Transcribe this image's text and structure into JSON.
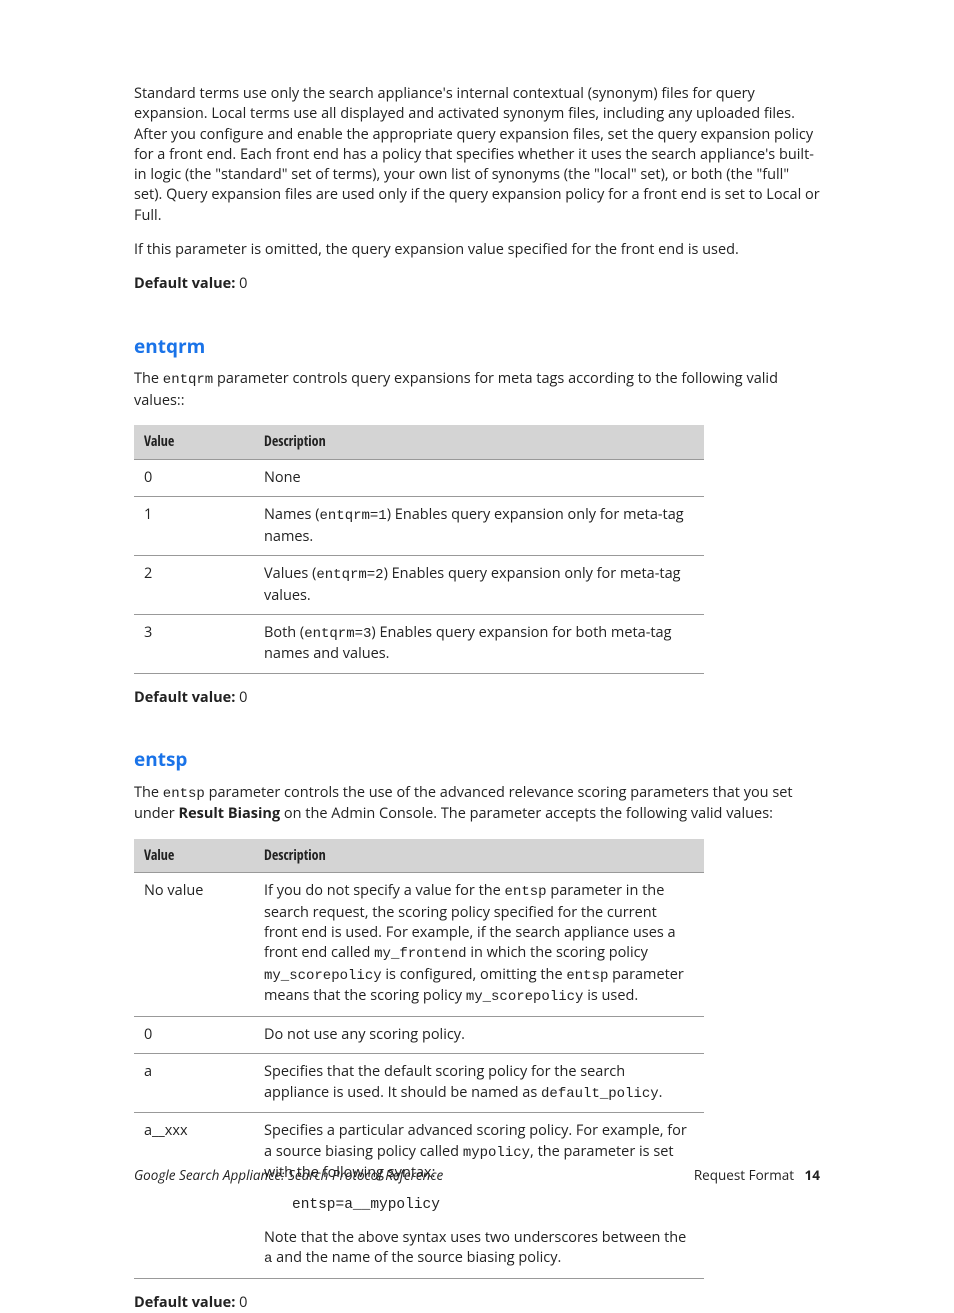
{
  "intro": {
    "p1": "Standard terms use only the search appliance's internal contextual (synonym) files for query expansion. Local terms use all displayed and activated synonym files, including any uploaded files. After you configure and enable the appropriate query expansion files, set the query expansion policy for a front end. Each front end has a policy that specifies whether it uses the search appliance's built-in logic (the \"standard\" set of terms), your own list of synonyms (the \"local\" set), or both (the \"full\" set). Query expansion files are used only if the query expansion policy for a front end is set to Local or Full.",
    "p2": "If this parameter is omitted, the query expansion value specified for the front end is used.",
    "default_label": "Default value:",
    "default_value": "0"
  },
  "entqrm": {
    "heading": "entqrm",
    "intro_pre": "The ",
    "intro_code": "entqrm",
    "intro_post": " parameter controls query expansions for meta tags according to the following valid values::",
    "th_value": "Value",
    "th_desc": "Description",
    "rows": [
      {
        "v": "0",
        "d_pre": "None",
        "d_code": "",
        "d_post": ""
      },
      {
        "v": "1",
        "d_pre": "Names (",
        "d_code": "entqrm=1",
        "d_post": ") Enables query expansion only for meta-tag names."
      },
      {
        "v": "2",
        "d_pre": "Values (",
        "d_code": "entqrm=2",
        "d_post": ") Enables query expansion only for meta-tag values."
      },
      {
        "v": "3",
        "d_pre": "Both (",
        "d_code": "entqrm=3",
        "d_post": ")  Enables query expansion for both meta-tag names and values."
      }
    ],
    "default_label": "Default value:",
    "default_value": "0"
  },
  "entsp": {
    "heading": "entsp",
    "intro_pre": "The ",
    "intro_code": "entsp",
    "intro_post": " parameter controls the use of the advanced relevance scoring parameters that you set under ",
    "intro_bold": "Result Biasing",
    "intro_after": " on the Admin Console. The parameter accepts the following valid values:",
    "th_value": "Value",
    "th_desc": "Description",
    "row_novalue": {
      "v": "No value",
      "t1": "If you do not specify a value for the ",
      "c1": "entsp",
      "t2": " parameter in the search request, the scoring policy specified for the current front end is used. For example, if the search appliance uses a front end called ",
      "c2": "my_frontend",
      "t3": " in which the scoring policy ",
      "c3": "my_scorepolicy",
      "t4": " is configured, omitting the ",
      "c4": "entsp",
      "t5": " parameter means that the scoring policy ",
      "c5": "my_scorepolicy",
      "t6": " is used."
    },
    "row_0": {
      "v": "0",
      "d": "Do not use any scoring policy."
    },
    "row_a": {
      "v": "a",
      "t1": "Specifies that the default scoring policy for the search appliance is used. It should be named as ",
      "c1": "default_policy",
      "t2": "."
    },
    "row_axxx": {
      "v": "a__xxx",
      "t1": "Specifies a particular advanced scoring policy. For example, for a source biasing policy called ",
      "c1": "mypolicy",
      "t2": ", the parameter is set with the following syntax:",
      "code": "entsp=a__mypolicy",
      "t3": "Note that the above syntax uses two underscores between the ",
      "c2": "a",
      "t4": " and the name of the source biasing policy."
    },
    "default_label": "Default value:",
    "default_value": "0"
  },
  "footer": {
    "left": "Google Search Appliance: Search Protocol Reference",
    "section": "Request Format",
    "page": "14"
  }
}
